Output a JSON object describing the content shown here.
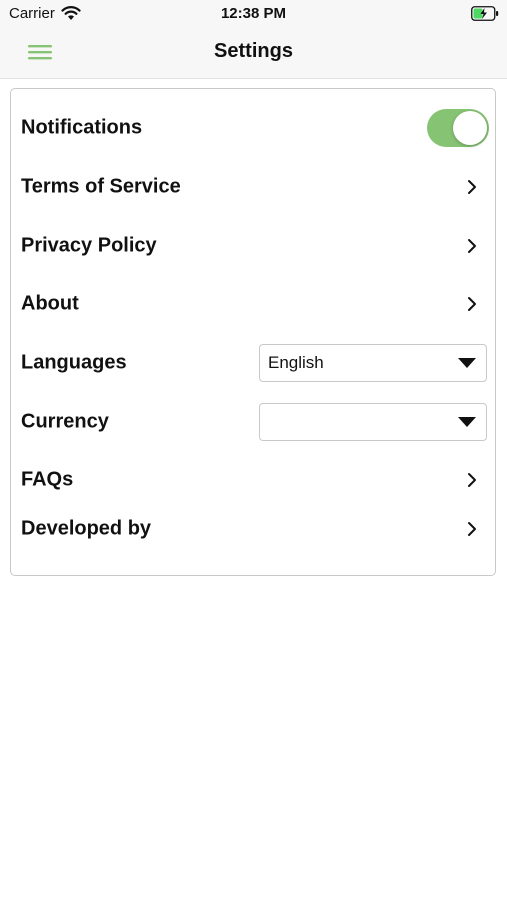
{
  "status_bar": {
    "carrier": "Carrier",
    "time": "12:38 PM",
    "icons": [
      "wifi-icon",
      "battery-charging-icon"
    ]
  },
  "nav": {
    "title": "Settings",
    "menu_icon": "hamburger-menu-icon",
    "accent_color": "#86c373"
  },
  "settings": {
    "notifications": {
      "label": "Notifications",
      "enabled": true
    },
    "terms": {
      "label": "Terms of Service"
    },
    "privacy": {
      "label": "Privacy Policy"
    },
    "about": {
      "label": "About"
    },
    "languages": {
      "label": "Languages",
      "selected": "English"
    },
    "currency": {
      "label": "Currency",
      "selected": ""
    },
    "faqs": {
      "label": "FAQs"
    },
    "developed_by": {
      "label": "Developed by"
    }
  }
}
